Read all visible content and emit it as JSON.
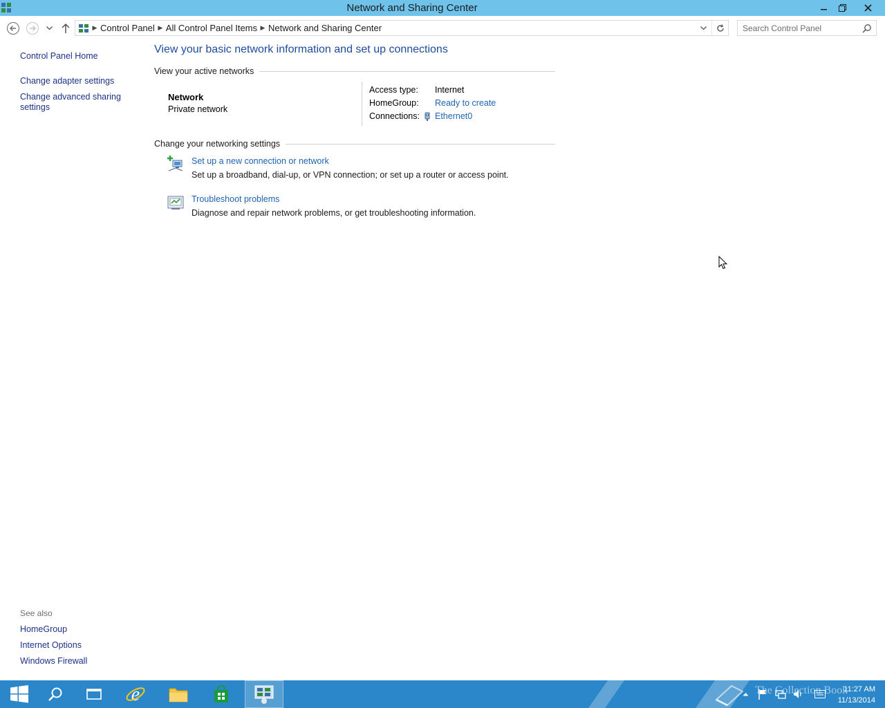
{
  "window": {
    "title": "Network and Sharing Center"
  },
  "address_bar": {
    "breadcrumbs": [
      "Control Panel",
      "All Control Panel Items",
      "Network and Sharing Center"
    ],
    "search_placeholder": "Search Control Panel"
  },
  "left_pane": {
    "home": "Control Panel Home",
    "links": [
      "Change adapter settings",
      "Change advanced sharing settings"
    ],
    "see_also_label": "See also",
    "see_also": [
      "HomeGroup",
      "Internet Options",
      "Windows Firewall"
    ]
  },
  "main": {
    "title": "View your basic network information and set up connections",
    "active_networks_heading": "View your active networks",
    "network": {
      "name": "Network",
      "type": "Private network",
      "access_type_label": "Access type:",
      "access_type_value": "Internet",
      "homegroup_label": "HomeGroup:",
      "homegroup_value": "Ready to create",
      "connections_label": "Connections:",
      "connections_value": "Ethernet0"
    },
    "change_settings_heading": "Change your networking settings",
    "tasks": [
      {
        "link": "Set up a new connection or network",
        "description": "Set up a broadband, dial-up, or VPN connection; or set up a router or access point.",
        "icon": "new-connection-icon"
      },
      {
        "link": "Troubleshoot problems",
        "description": "Diagnose and repair network problems, or get troubleshooting information.",
        "icon": "troubleshoot-icon"
      }
    ]
  },
  "taskbar": {
    "apps": [
      "start-icon",
      "search-icon",
      "task-view-icon",
      "internet-explorer-icon",
      "file-explorer-icon",
      "store-icon",
      "control-panel-icon"
    ],
    "watermark": "The Collection Book",
    "time": "11:27 AM",
    "date": "11/13/2014"
  },
  "colors": {
    "titlebar": "#6fc3ea",
    "link": "#1e63b4",
    "taskbar": "#2b87c9"
  }
}
